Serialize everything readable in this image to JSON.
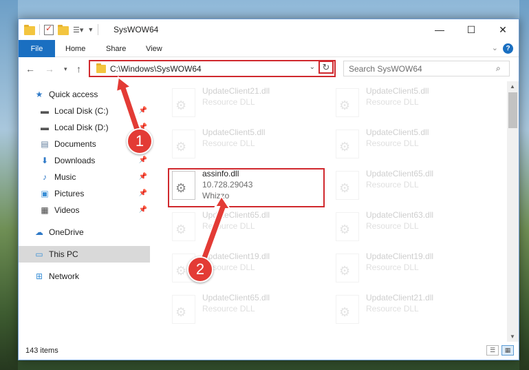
{
  "window": {
    "title": "SysWOW64",
    "minimize_glyph": "—",
    "maximize_glyph": "☐",
    "close_glyph": "✕"
  },
  "ribbon": {
    "file": "File",
    "home": "Home",
    "share": "Share",
    "view": "View",
    "help": "?"
  },
  "address": {
    "path": "C:\\Windows\\SysWOW64",
    "search_placeholder": "Search SysWOW64"
  },
  "nav": {
    "quick_access": "Quick access",
    "local_c": "Local Disk (C:)",
    "local_d": "Local Disk (D:)",
    "documents": "Documents",
    "downloads": "Downloads",
    "music": "Music",
    "pictures": "Pictures",
    "videos": "Videos",
    "onedrive": "OneDrive",
    "this_pc": "This PC",
    "network": "Network"
  },
  "files": {
    "left": [
      {
        "name": "UpdateClient21.dll",
        "line1": "Resource DLL"
      },
      {
        "name": "UpdateClient5.dll",
        "line1": "Resource DLL"
      },
      {
        "name": "assinfo.dll",
        "line1": "10.728.29043",
        "line2": "Whizzo"
      },
      {
        "name": "UpdateClient65.dll",
        "line1": "Resource DLL"
      },
      {
        "name": "UpdateClient19.dll",
        "line1": "Resource DLL"
      },
      {
        "name": "UpdateClient65.dll",
        "line1": "Resource DLL"
      }
    ],
    "right": [
      {
        "name": "UpdateClient5.dll",
        "line1": "Resource DLL"
      },
      {
        "name": "UpdateClient5.dll",
        "line1": "Resource DLL"
      },
      {
        "name": "UpdateClient65.dll",
        "line1": "Resource DLL"
      },
      {
        "name": "UpdateClient63.dll",
        "line1": "Resource DLL"
      },
      {
        "name": "UpdateClient19.dll",
        "line1": "Resource DLL"
      },
      {
        "name": "UpdateClient21.dll",
        "line1": "Resource DLL"
      }
    ]
  },
  "status": {
    "item_count": "143 items"
  },
  "annotations": {
    "step1": "1",
    "step2": "2",
    "highlight_color": "#d0282d",
    "badge_color": "#e33b35"
  },
  "colors": {
    "accent": "#1a6fc1"
  }
}
